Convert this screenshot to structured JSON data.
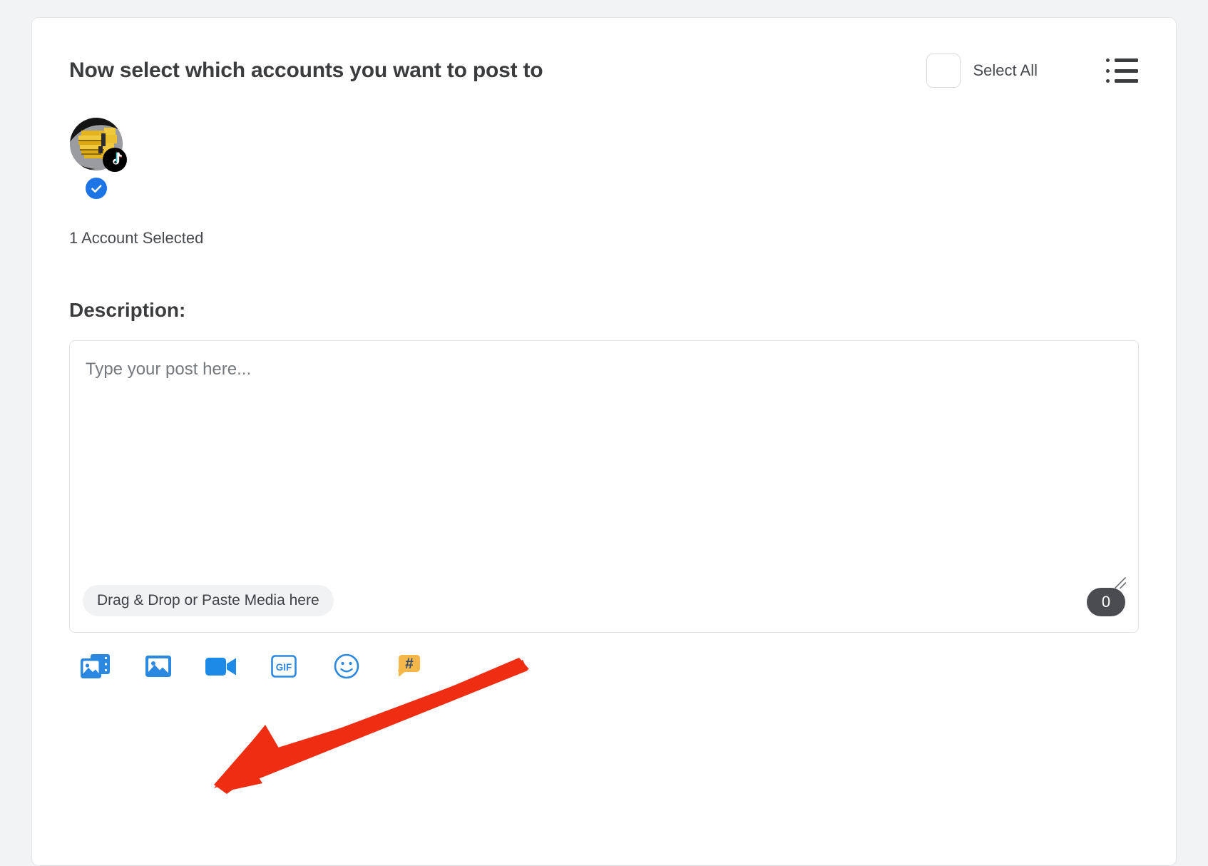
{
  "header": {
    "title": "Now select which accounts you want to post to",
    "select_all_label": "Select All",
    "select_all_checked": false,
    "list_view_icon": "list-icon"
  },
  "accounts": {
    "items": [
      {
        "platform": "tiktok",
        "platform_icon": "tiktok-icon",
        "selected": true,
        "selected_icon": "check-circle-icon"
      }
    ],
    "selected_summary": "1 Account Selected"
  },
  "description": {
    "heading": "Description:",
    "placeholder": "Type your post here...",
    "value": "",
    "drop_hint": "Drag & Drop or Paste Media here",
    "media_count": "0",
    "resize_handle_icon": "resize-handle-icon"
  },
  "toolbar": {
    "items": [
      {
        "name": "media-gallery-icon",
        "label": "Media Gallery",
        "color": "#2b88e0"
      },
      {
        "name": "image-icon",
        "label": "Image",
        "color": "#2b88e0"
      },
      {
        "name": "video-camera-icon",
        "label": "Video",
        "color": "#1e8ae8"
      },
      {
        "name": "gif-icon",
        "label": "GIF",
        "color": "#2b88e0"
      },
      {
        "name": "emoji-smiley-icon",
        "label": "Emoji",
        "color": "#2b88e0"
      },
      {
        "name": "hashtag-icon",
        "label": "Hashtag",
        "color": "#f5b64a"
      }
    ],
    "gif_label": "GIF",
    "hashtag_glyph": "#"
  },
  "annotation": {
    "arrow_color": "#ee2d13",
    "points_to": "video-camera-icon"
  },
  "colors": {
    "accent_blue": "#2b88e0",
    "check_blue": "#1d74e5",
    "hashtag_orange": "#f5b64a",
    "arrow_red": "#ee2d13",
    "page_bg": "#f2f3f5",
    "card_bg": "#ffffff",
    "text_dark": "#3a3c3e",
    "text_muted": "#75787c"
  }
}
